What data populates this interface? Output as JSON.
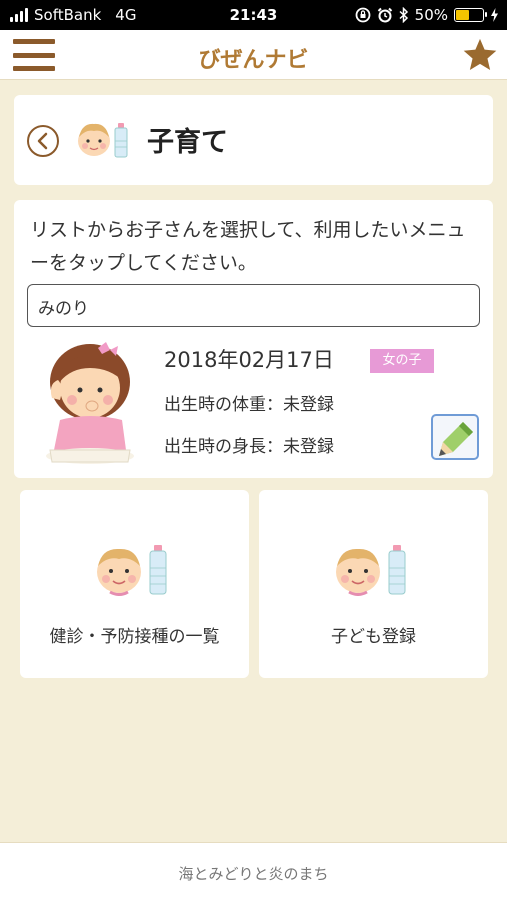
{
  "status_bar": {
    "carrier": "SoftBank",
    "network": "4G",
    "time": "21:43",
    "battery": "50%",
    "battery_level": 0.5,
    "icons": [
      "screen-rotation-lock-icon",
      "alarm-icon",
      "bluetooth-icon",
      "battery-icon",
      "charging-icon"
    ]
  },
  "header": {
    "title": "びぜんナビ",
    "menu_icon": "hamburger-menu-icon",
    "favorite_icon": "star-icon"
  },
  "title_card": {
    "title": "子育て",
    "back_icon": "chevron-left-circle-icon",
    "icon": "baby-bottle-icon"
  },
  "child_card": {
    "instruction": "リストからお子さんを選択して、利用したいメニューをタップしてください。",
    "selected_child": "みのり",
    "birth_date": "2018年02月17日",
    "gender": "女の子",
    "birth_weight": "出生時の体重：未登録",
    "birth_height": "出生時の身長：未登録",
    "edit_icon": "pencil-edit-icon"
  },
  "menu": [
    {
      "label": "健診・予防接種の一覧",
      "icon": "baby-bottle-icon"
    },
    {
      "label": "子ども登録",
      "icon": "baby-bottle-icon"
    }
  ],
  "footer": {
    "text": "海とみどりと炎のまち"
  },
  "colors": {
    "background": "#f4eed8",
    "brand_brown": "#8b5a2b",
    "title_gold": "#b07a34",
    "badge_pink": "#e79ad6",
    "edit_blue": "#6f9bd6"
  }
}
